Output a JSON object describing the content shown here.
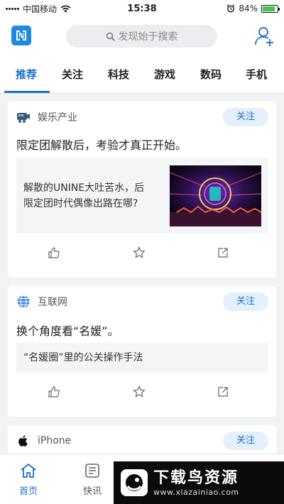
{
  "status_bar": {
    "carrier": "中国移动",
    "time": "15:38",
    "battery_text": "84%",
    "battery_level": 0.84,
    "battery_color": "#3fc54a"
  },
  "header": {
    "logo_icon": "app-logo-icon",
    "search_placeholder": "发现始于搜索",
    "add_user_icon": "add-user-icon"
  },
  "tabs": [
    {
      "label": "推荐",
      "active": true
    },
    {
      "label": "关注"
    },
    {
      "label": "科技"
    },
    {
      "label": "游戏"
    },
    {
      "label": "数码"
    },
    {
      "label": "手机"
    }
  ],
  "feed": [
    {
      "category": "娱乐产业",
      "follow_label": "关注",
      "title": "限定团解散后，考验才真正开始。",
      "article_line1": "解散的UNINE大吐苦水，后",
      "article_line2": "限定团时代偶像出路在哪?"
    },
    {
      "category": "互联网",
      "follow_label": "关注",
      "title": "换个角度看“名媛”。",
      "article_line1": "“名媛圈”里的公关操作手法"
    },
    {
      "category": "iPhone",
      "follow_label": "关注"
    }
  ],
  "bottom_nav": [
    {
      "label": "首页",
      "icon": "home-icon",
      "active": true
    },
    {
      "label": "快讯",
      "icon": "news-icon"
    }
  ],
  "watermark": {
    "title": "下载鸟资源",
    "url": "www.xiazainiao.com"
  },
  "colors": {
    "accent": "#1b6fd1",
    "logo_blue": "#1e88e5",
    "follow_bg": "#e4f0fb"
  }
}
